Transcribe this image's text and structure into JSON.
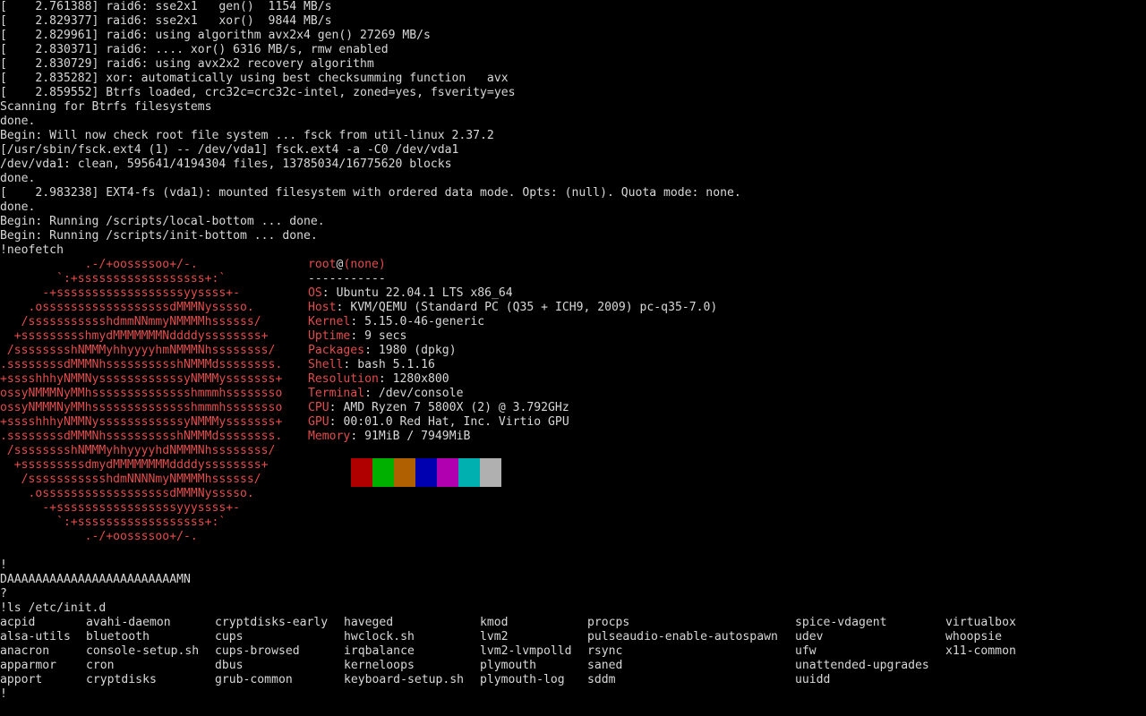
{
  "boot_lines": [
    "[    2.761388] raid6: sse2x1   gen()  1154 MB/s",
    "[    2.829377] raid6: sse2x1   xor()  9844 MB/s",
    "[    2.829961] raid6: using algorithm avx2x4 gen() 27269 MB/s",
    "[    2.830371] raid6: .... xor() 6316 MB/s, rmw enabled",
    "[    2.830729] raid6: using avx2x2 recovery algorithm",
    "[    2.835282] xor: automatically using best checksumming function   avx",
    "[    2.859552] Btrfs loaded, crc32c=crc32c-intel, zoned=yes, fsverity=yes",
    "Scanning for Btrfs filesystems",
    "done.",
    "Begin: Will now check root file system ... fsck from util-linux 2.37.2",
    "[/usr/sbin/fsck.ext4 (1) -- /dev/vda1] fsck.ext4 -a -C0 /dev/vda1",
    "/dev/vda1: clean, 595641/4194304 files, 13785034/16775620 blocks",
    "done.",
    "[    2.983238] EXT4-fs (vda1): mounted filesystem with ordered data mode. Opts: (null). Quota mode: none.",
    "done.",
    "Begin: Running /scripts/local-bottom ... done.",
    "Begin: Running /scripts/init-bottom ... done.",
    "!neofetch"
  ],
  "logo_lines": [
    "            .-/+oossssoo+/-.",
    "        `:+ssssssssssssssssss+:`",
    "      -+ssssssssssssssssssyyssss+-",
    "    .ossssssssssssssssssdMMMNysssso.",
    "   /ssssssssssshdmmNNmmyNMMMMhssssss/",
    "  +ssssssssshmydMMMMMMMNddddyssssssss+",
    " /sssssssshNMMMyhhyyyyhmNMMMNhssssssss/",
    ".ssssssssdMMMNhsssssssssshNMMMdssssssss.",
    "+sssshhhyNMMNyssssssssssssyNMMMysssssss+",
    "ossyNMMMNyMMhsssssssssssssshmmmhssssssso",
    "ossyNMMMNyMMhsssssssssssssshmmmhssssssso",
    "+sssshhhyNMMNyssssssssssssyNMMMysssssss+",
    ".ssssssssdMMMNhsssssssssshNMMMdssssssss.",
    " /sssssssshNMMMyhhyyyyhdNMMMNhssssssss/",
    "  +sssssssssdmydMMMMMMMMddddyssssssss+",
    "   /ssssssssssshdmNNNNmyNMMMMhssssss/",
    "    .ossssssssssssssssssdMMMNysssso.",
    "      -+sssssssssssssssssyyyssss+-",
    "        `:+ssssssssssssssssss+:`",
    "            .-/+oossssoo+/-."
  ],
  "info": {
    "user": "root",
    "at": "@",
    "host": "(none)",
    "separator": "-----------",
    "rows": [
      {
        "key": "OS",
        "value": "Ubuntu 22.04.1 LTS x86_64"
      },
      {
        "key": "Host",
        "value": "KVM/QEMU (Standard PC (Q35 + ICH9, 2009) pc-q35-7.0)"
      },
      {
        "key": "Kernel",
        "value": "5.15.0-46-generic"
      },
      {
        "key": "Uptime",
        "value": "9 secs"
      },
      {
        "key": "Packages",
        "value": "1980 (dpkg)"
      },
      {
        "key": "Shell",
        "value": "bash 5.1.16"
      },
      {
        "key": "Resolution",
        "value": "1280x800"
      },
      {
        "key": "Terminal",
        "value": "/dev/console"
      },
      {
        "key": "CPU",
        "value": "AMD Ryzen 7 5800X (2) @ 3.792GHz"
      },
      {
        "key": "GPU",
        "value": "00:01.0 Red Hat, Inc. Virtio GPU"
      },
      {
        "key": "Memory",
        "value": "91MiB / 7949MiB"
      }
    ]
  },
  "palette_colors": [
    "#000000",
    "#b00000",
    "#00b000",
    "#b06000",
    "#0000b0",
    "#b000b0",
    "#00b0b0",
    "#b0b0b0"
  ],
  "after_lines": [
    "!",
    "DAAAAAAAAAAAAAAAAAAAAAAAAMN",
    "?",
    "!ls /etc/init.d"
  ],
  "ls_columns": [
    [
      "acpid",
      "alsa-utils",
      "anacron",
      "apparmor",
      "apport"
    ],
    [
      "avahi-daemon",
      "bluetooth",
      "console-setup.sh",
      "cron",
      "cryptdisks"
    ],
    [
      "cryptdisks-early",
      "cups",
      "cups-browsed",
      "dbus",
      "grub-common"
    ],
    [
      "haveged",
      "hwclock.sh",
      "irqbalance",
      "kerneloops",
      "keyboard-setup.sh"
    ],
    [
      "kmod",
      "lvm2",
      "lvm2-lvmpolld",
      "plymouth",
      "plymouth-log"
    ],
    [
      "procps",
      "pulseaudio-enable-autospawn",
      "rsync",
      "saned",
      "sddm"
    ],
    [
      "spice-vdagent",
      "udev",
      "ufw",
      "unattended-upgrades",
      "uuidd"
    ],
    [
      "virtualbox",
      "whoopsie",
      "x11-common"
    ]
  ],
  "final_prompt": "!",
  "colors": {
    "accent": "#e34c4c",
    "text": "#d8d8d8",
    "background": "#000000"
  }
}
